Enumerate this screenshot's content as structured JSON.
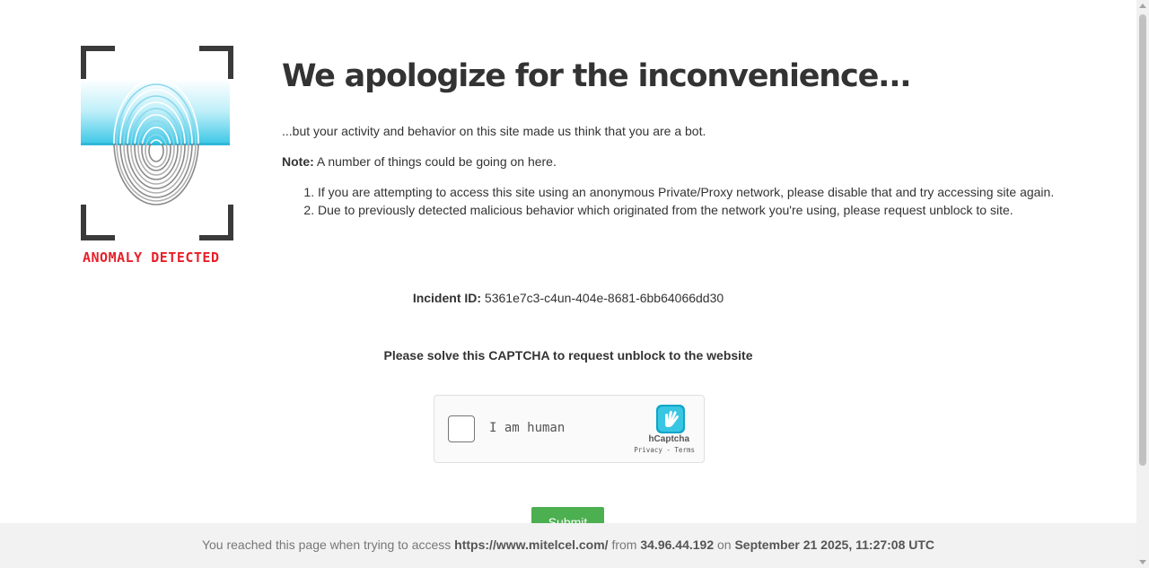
{
  "logo": {
    "caption": "ANOMALY DETECTED",
    "icon": "fingerprint-scan-icon"
  },
  "headline": "We apologize for the inconvenience...",
  "lead": "...but your activity and behavior on this site made us think that you are a bot.",
  "note": {
    "label": "Note:",
    "text": " A number of things could be going on here."
  },
  "reasons": [
    "If you are attempting to access this site using an anonymous Private/Proxy network, please disable that and try accessing site again.",
    "Due to previously detected malicious behavior which originated from the network you're using, please request unblock to site."
  ],
  "incident": {
    "label": "Incident ID:",
    "value": " 5361e7c3-c4un-404e-8681-6bb64066dd30"
  },
  "captcha_prompt": "Please solve this CAPTCHA to request unblock to the website",
  "captcha": {
    "checkbox_label": "I am human",
    "brand": "hCaptcha",
    "privacy": "Privacy",
    "separator": " - ",
    "terms": "Terms",
    "checked": false
  },
  "submit_label": "Submit",
  "footer": {
    "prefix": "You reached this page when trying to access ",
    "url": "https://www.mitelcel.com/",
    "from": " from ",
    "ip": "34.96.44.192",
    "on": " on ",
    "datetime": "September 21 2025, 11:27:08 UTC"
  },
  "colors": {
    "accent_red": "#e8202a",
    "submit_green": "#4caf50",
    "scan_cyan": "#5fd3ea"
  }
}
